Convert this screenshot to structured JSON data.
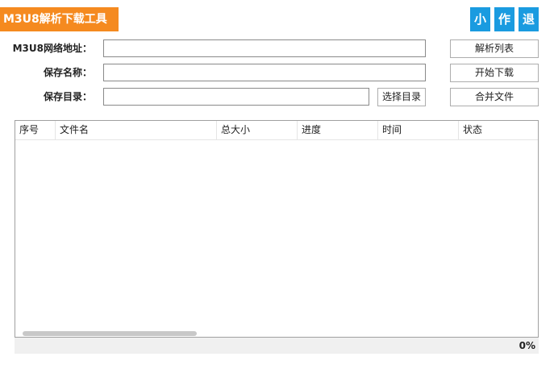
{
  "app": {
    "title": "M3U8解析下载工具"
  },
  "window_buttons": {
    "minimize_label": "小",
    "author_label": "作",
    "exit_label": "退"
  },
  "form": {
    "url_label": "M3U8网络地址：",
    "url_value": "",
    "name_label": "保存名称：",
    "name_value": "",
    "dir_label": "保存目录：",
    "dir_value": "",
    "choose_dir_label": "选择目录"
  },
  "actions": {
    "parse_list_label": "解析列表",
    "start_download_label": "开始下载",
    "merge_files_label": "合并文件"
  },
  "table": {
    "columns": [
      "序号",
      "文件名",
      "总大小",
      "进度",
      "时间",
      "状态"
    ],
    "rows": []
  },
  "status": {
    "progress_text": "0%",
    "progress_fraction": 0
  },
  "colors": {
    "title_badge": "#f58a1f",
    "window_buttons": "#1a9be0"
  }
}
